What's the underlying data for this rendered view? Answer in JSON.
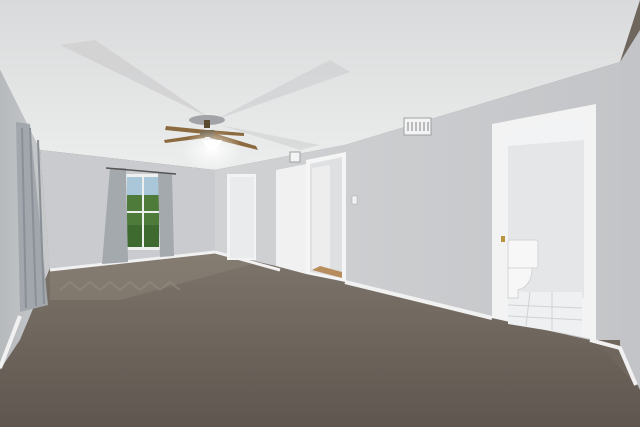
{
  "scene": {
    "description_visible_text": "",
    "palette": {
      "ceiling": "#e6e7e8",
      "wall_back": "#cfd1d3",
      "wall_right": "#c9cbcd",
      "wall_left": "#bfc2c5",
      "carpet": "#6a6259",
      "carpet_light": "#7e766c",
      "trim": "#f4f4f4",
      "door": "#f2f2f2",
      "window_green": "#4e7a3a",
      "curtain": "#9aa0a6",
      "bath_tile": "#eef0f2"
    },
    "objects": [
      "ceiling-fan-icon",
      "window",
      "curtains",
      "closet-door",
      "bedroom-door",
      "bathroom-doorway",
      "toilet",
      "hvac-vent",
      "light-switch",
      "carpet-floor"
    ]
  }
}
